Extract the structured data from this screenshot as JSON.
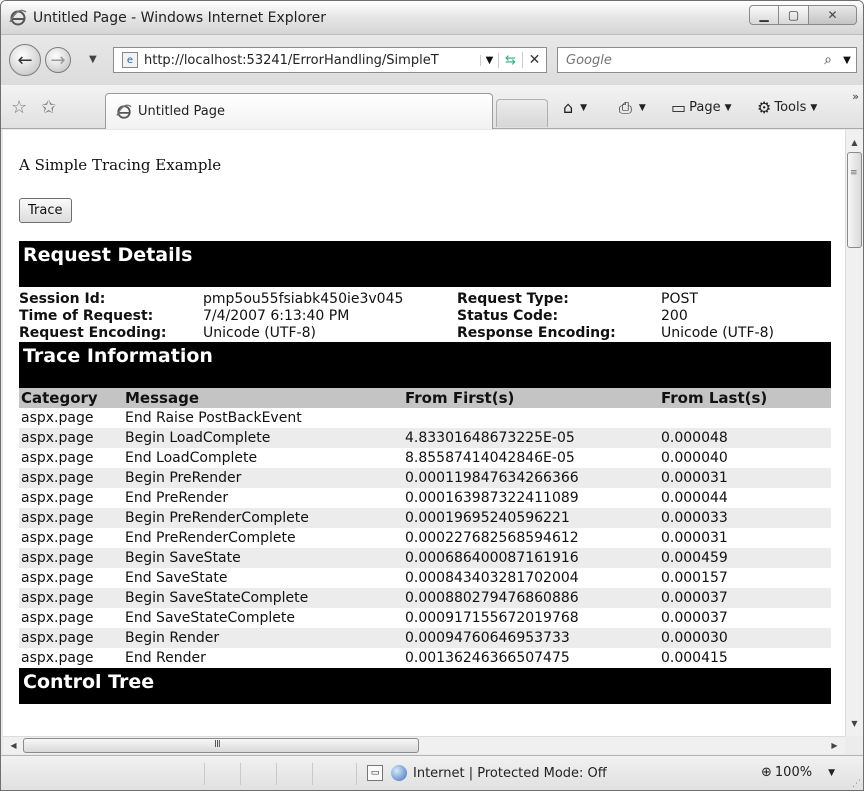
{
  "window": {
    "title": "Untitled Page - Windows Internet Explorer"
  },
  "address_bar": {
    "url": "http://localhost:53241/ErrorHandling/SimpleT",
    "search_placeholder": "Google"
  },
  "command_bar": {
    "tab_label": "Untitled Page",
    "page_label": "Page",
    "tools_label": "Tools"
  },
  "page": {
    "heading": "A Simple Tracing Example",
    "trace_button": "Trace",
    "request_details": {
      "title": "Request Details",
      "rows": [
        {
          "label1": "Session Id:",
          "value1": "pmp5ou55fsiabk450ie3v045",
          "label2": "Request Type:",
          "value2": "POST"
        },
        {
          "label1": "Time of Request:",
          "value1": "7/4/2007 6:13:40 PM",
          "label2": "Status Code:",
          "value2": "200"
        },
        {
          "label1": "Request Encoding:",
          "value1": "Unicode (UTF-8)",
          "label2": "Response Encoding:",
          "value2": "Unicode (UTF-8)"
        }
      ]
    },
    "trace_information": {
      "title": "Trace Information",
      "headers": [
        "Category",
        "Message",
        "From First(s)",
        "From Last(s)"
      ],
      "rows": [
        [
          "aspx.page",
          "End Raise PostBackEvent",
          "",
          ""
        ],
        [
          "aspx.page",
          "Begin LoadComplete",
          "4.83301648673225E-05",
          "0.000048"
        ],
        [
          "aspx.page",
          "End LoadComplete",
          "8.85587414042846E-05",
          "0.000040"
        ],
        [
          "aspx.page",
          "Begin PreRender",
          "0.000119847634266366",
          "0.000031"
        ],
        [
          "aspx.page",
          "End PreRender",
          "0.000163987322411089",
          "0.000044"
        ],
        [
          "aspx.page",
          "Begin PreRenderComplete",
          "0.00019695240596221",
          "0.000033"
        ],
        [
          "aspx.page",
          "End PreRenderComplete",
          "0.000227682568594612",
          "0.000031"
        ],
        [
          "aspx.page",
          "Begin SaveState",
          "0.000686400087161916",
          "0.000459"
        ],
        [
          "aspx.page",
          "End SaveState",
          "0.000843403281702004",
          "0.000157"
        ],
        [
          "aspx.page",
          "Begin SaveStateComplete",
          "0.000880279476860886",
          "0.000037"
        ],
        [
          "aspx.page",
          "End SaveStateComplete",
          "0.000917155672019768",
          "0.000037"
        ],
        [
          "aspx.page",
          "Begin Render",
          "0.00094760646953733",
          "0.000030"
        ],
        [
          "aspx.page",
          "End Render",
          "0.00136246366507475",
          "0.000415"
        ]
      ]
    },
    "control_tree": {
      "title": "Control Tree"
    }
  },
  "status_bar": {
    "zone": "Internet | Protected Mode: Off",
    "zoom": "100%"
  },
  "scrollbar": {
    "hscroll_grip": "III"
  }
}
